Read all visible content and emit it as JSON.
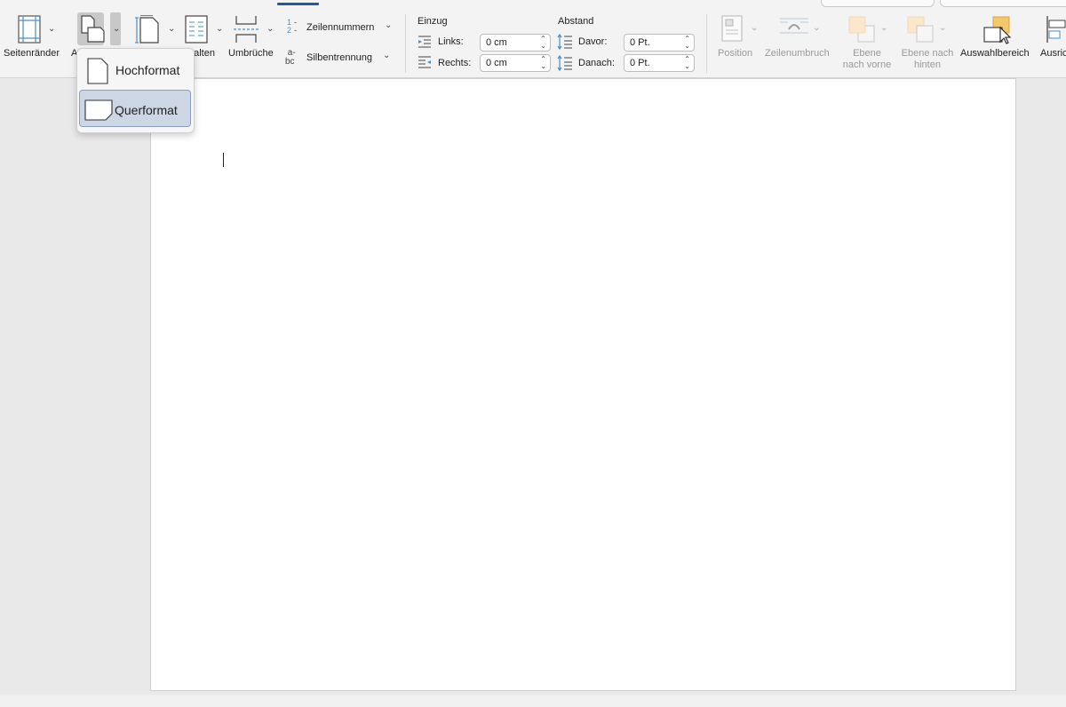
{
  "ribbon": {
    "seitenraender_label": "Seitenränder",
    "ausrichtung_label_partial": "A",
    "spalten_label": "palten",
    "umbrueche_label": "Umbrüche",
    "zeilennummern_label": "Zeilennummern",
    "silbentrennung_label": "Silbentrennung",
    "einzug": {
      "title": "Einzug",
      "links_label": "Links:",
      "links_value": "0 cm",
      "rechts_label": "Rechts:",
      "rechts_value": "0 cm"
    },
    "abstand": {
      "title": "Abstand",
      "davor_label": "Davor:",
      "davor_value": "0 Pt.",
      "danach_label": "Danach:",
      "danach_value": "0 Pt."
    },
    "position_label": "Position",
    "zeilenumbruch_label": "Zeilenumbruch",
    "ebene_vorne_line1": "Ebene",
    "ebene_vorne_line2": "nach vorne",
    "ebene_hinten_line1": "Ebene nach",
    "ebene_hinten_line2": "hinten",
    "auswahlbereich_label": "Auswahlbereich",
    "ausrichten_label_partial": "Ausric"
  },
  "orientation_menu": {
    "items": [
      {
        "label": "Hochformat",
        "selected": false,
        "icon": "portrait-page-icon"
      },
      {
        "label": "Querformat",
        "selected": true,
        "icon": "landscape-page-icon"
      }
    ]
  },
  "colors": {
    "accent": "#2b579a",
    "selected_bg": "#cdd6e4",
    "disabled_text": "#9a9a9a",
    "layer_orange": "#f5c76b"
  }
}
